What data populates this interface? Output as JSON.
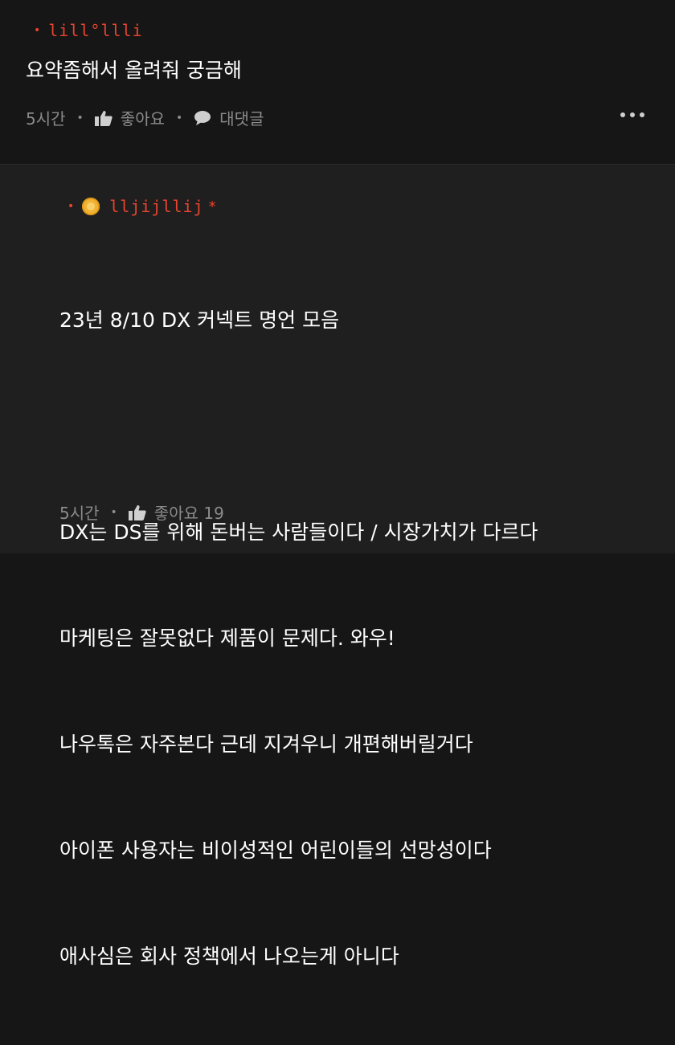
{
  "comment": {
    "author": "lill°llli",
    "text": "요약좀해서 올려줘 궁금해",
    "time": "5시간",
    "like_label": "좋아요",
    "reply_label": "대댓글"
  },
  "reply": {
    "author": "lljijllij",
    "author_mark": "*",
    "lines": [
      "23년 8/10 DX 커넥트 명언 모음",
      "",
      "DX는 DS를 위해 돈버는 사람들이다 / 시장가치가 다르다",
      "마케팅은 잘못없다 제품이 문제다. 와우!",
      "나우톡은 자주본다 근데 지겨우니 개편해버릴거다",
      "아이폰 사용자는 비이성적인 어린이들의 선망성이다",
      "애사심은 회사 정책에서 나오는게 아니다"
    ],
    "time": "5시간",
    "like_label": "좋아요 19"
  },
  "colors": {
    "author": "#e8442e",
    "meta": "#8b8b8b",
    "background_top": "#161616",
    "background_reply": "#1f1f1f"
  },
  "icons": [
    "thumbs-up-icon",
    "speech-bubble-icon",
    "more-dots-icon",
    "gold-badge-icon"
  ]
}
